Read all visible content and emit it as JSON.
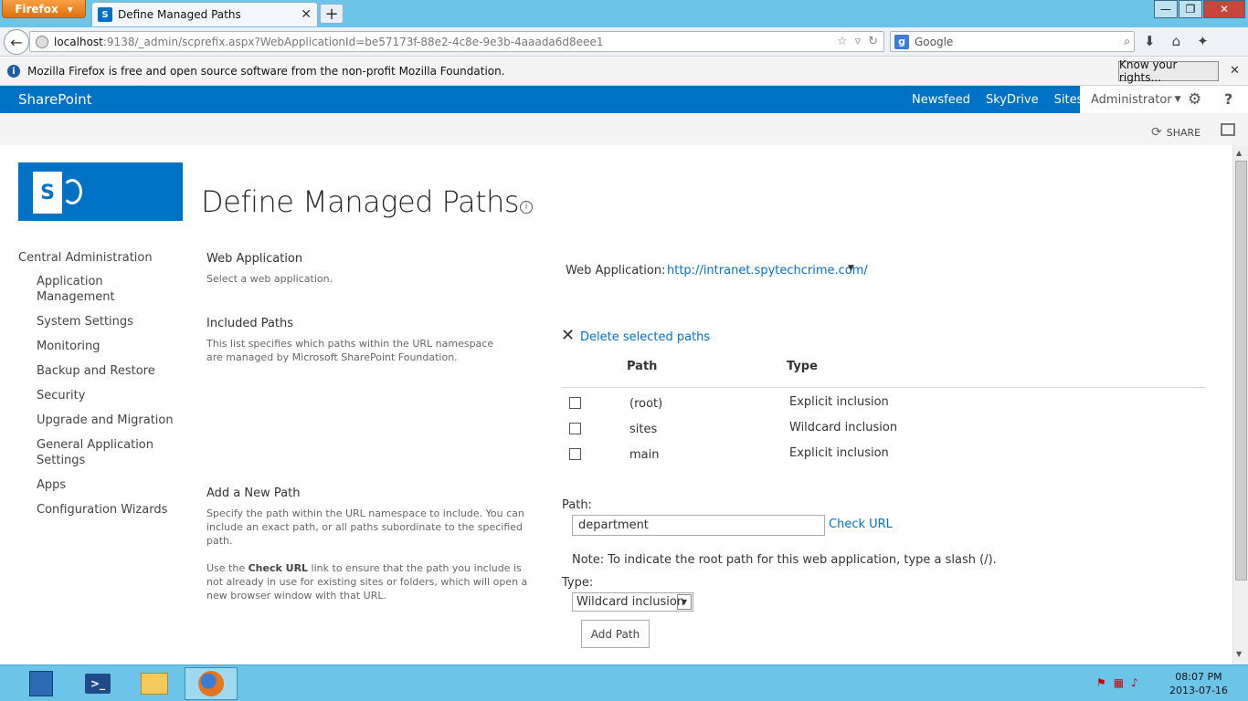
{
  "browser": {
    "menu_button": "Firefox",
    "tab_title": "Define Managed Paths",
    "url_host": "localhost",
    "url_rest": ":9138/_admin/scprefix.aspx?WebApplicationId=be57173f-88e2-4c8e-9e3b-4aaada6d8eee1",
    "search_placeholder": "Google",
    "infobar_text": "Mozilla Firefox is free and open source software from the non-profit Mozilla Foundation.",
    "infobar_button": "Know your rights..."
  },
  "suitebar": {
    "brand": "SharePoint",
    "links": [
      "Newsfeed",
      "SkyDrive",
      "Sites"
    ],
    "user": "Administrator",
    "share": "SHARE"
  },
  "page": {
    "title": "Define Managed Paths"
  },
  "leftnav": {
    "heading": "Central Administration",
    "items": [
      "Application Management",
      "System Settings",
      "Monitoring",
      "Backup and Restore",
      "Security",
      "Upgrade and Migration",
      "General Application Settings",
      "Apps",
      "Configuration Wizards"
    ]
  },
  "sections": {
    "web_app": {
      "title": "Web Application",
      "desc": "Select a web application."
    },
    "included": {
      "title": "Included Paths",
      "desc": "This list specifies which paths within the URL namespace are managed by Microsoft SharePoint Foundation."
    },
    "add": {
      "title": "Add a New Path",
      "desc1": "Specify the path within the URL namespace to include. You can include an exact path, or all paths subordinate to the specified path.",
      "desc2_pre": "Use the ",
      "desc2_bold": "Check URL",
      "desc2_post": " link to ensure that the path you include is not already in use for existing sites or folders, which will open a new browser window with that URL."
    }
  },
  "form": {
    "web_app_label": "Web Application:",
    "web_app_value": "http://intranet.spytechcrime.com/",
    "delete_link": "Delete selected paths",
    "col_path": "Path",
    "col_type": "Type",
    "rows": [
      {
        "path": "(root)",
        "type": "Explicit inclusion"
      },
      {
        "path": "sites",
        "type": "Wildcard inclusion"
      },
      {
        "path": "main",
        "type": "Explicit inclusion"
      }
    ],
    "path_label": "Path:",
    "path_value": "department",
    "check_url": "Check URL",
    "note": "Note: To indicate the root path for this web application, type a slash (/).",
    "type_label": "Type:",
    "type_value": "Wildcard inclusion",
    "add_button": "Add Path"
  },
  "taskbar": {
    "time": "08:07 PM",
    "date": "2013-07-16"
  },
  "colors": {
    "sharepoint_blue": "#0072c6",
    "taskbar": "#6cc5e8"
  }
}
